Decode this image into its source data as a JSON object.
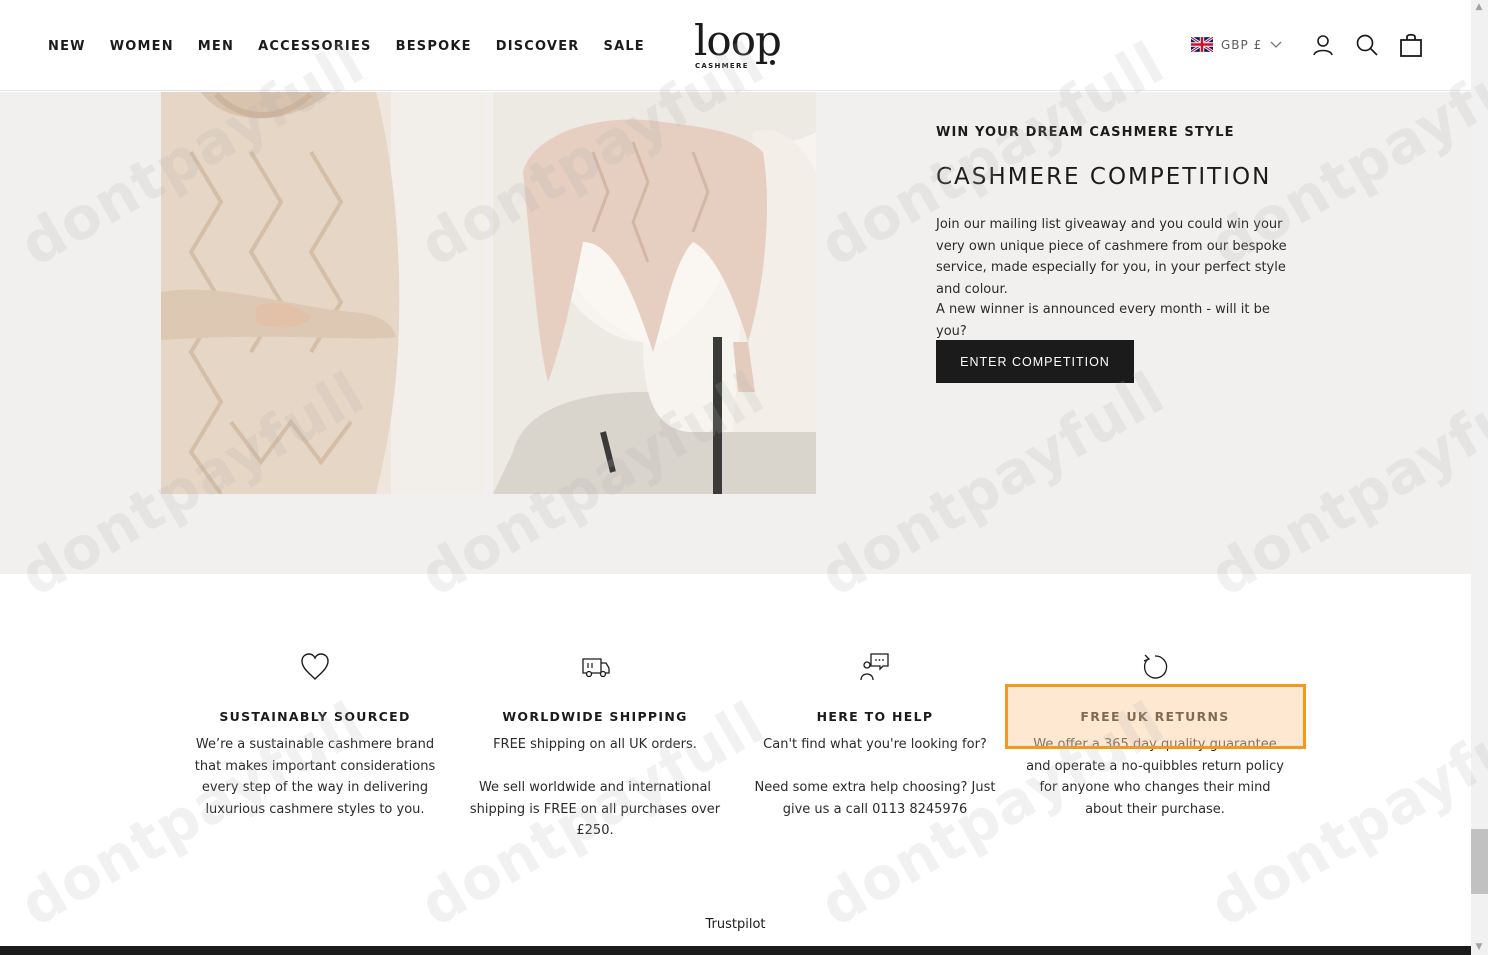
{
  "header": {
    "nav": [
      "NEW",
      "WOMEN",
      "MEN",
      "ACCESSORIES",
      "BESPOKE",
      "DISCOVER",
      "SALE"
    ],
    "logo": {
      "word": "loop",
      "sub": "CASHMERE"
    },
    "currency": "GBP £",
    "icons": [
      "uk-flag-icon",
      "chevron-down-icon",
      "account-icon",
      "search-icon",
      "bag-icon"
    ]
  },
  "competition": {
    "kicker": "WIN YOUR DREAM CASHMERE STYLE",
    "title": "CASHMERE COMPETITION",
    "paragraph1": "Join our mailing list giveaway and you could win your very own unique piece of cashmere from our bespoke service, made especially for you, in your perfect style and colour.",
    "paragraph2": "A new winner is announced every month - will it be you?",
    "button": "ENTER COMPETITION"
  },
  "features": [
    {
      "icon": "heart-icon",
      "title": "SUSTAINABLY SOURCED",
      "text": "We’re a sustainable cashmere brand that makes important considerations every step of the way in delivering luxurious cashmere styles to you."
    },
    {
      "icon": "truck-icon",
      "title": "WORLDWIDE SHIPPING",
      "text": "FREE shipping on all UK orders.\n\nWe sell worldwide and international shipping is FREE on all purchases over £250."
    },
    {
      "icon": "chat-icon",
      "title": "HERE TO HELP",
      "text": "Can't find what you're looking for?\n\nNeed some extra help choosing? Just give us a call 0113 8245976"
    },
    {
      "icon": "return-icon",
      "title": "FREE UK RETURNS",
      "text": "We offer a 365 day quality guarantee and operate a no-quibbles return policy for anyone who changes their mind about their purchase."
    }
  ],
  "trustpilot": "Trustpilot",
  "watermark": "dontpayfull",
  "colors": {
    "accent": "#1c1b1b",
    "section_bg": "#f1f0ee",
    "highlight_border": "#f39a1e"
  }
}
